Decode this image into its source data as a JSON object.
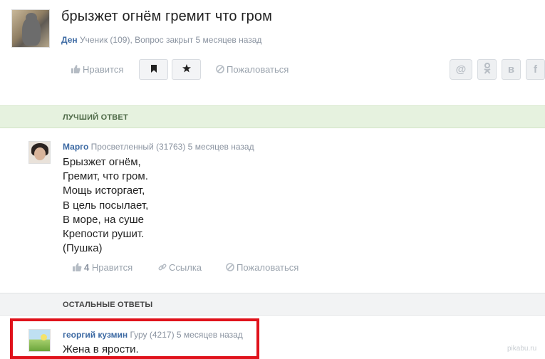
{
  "question": {
    "title": "брызжет огнём гремит что гром",
    "author": "Ден",
    "meta": "Ученик (109), Вопрос закрыт 5 месяцев назад"
  },
  "actions": {
    "like_label": "Нравится",
    "report_label": "Пожаловаться",
    "share_icons": [
      "@",
      "ok",
      "в",
      "f"
    ]
  },
  "best_answer": {
    "section_label": "ЛУЧШИЙ ОТВЕТ",
    "author": "Марго",
    "meta": "Просветленный (31763) 5 месяцев назад",
    "lines": [
      "Брызжет огнём,",
      "Гремит, что гром.",
      "Мощь исторгает,",
      "В цель посылает,",
      "В море, на суше",
      "Крепости рушит.",
      "(Пушка)"
    ],
    "likes_count": "4",
    "like_label": "Нравится",
    "link_label": "Ссылка",
    "report_label": "Пожаловаться"
  },
  "other_answers": {
    "section_label": "ОСТАЛЬНЫЕ ОТВЕТЫ",
    "items": [
      {
        "author": "георгий кузмин",
        "meta": "Гуру (4217) 5 месяцев назад",
        "text": "Жена в ярости."
      }
    ]
  },
  "watermark": "pikabu.ru",
  "colors": {
    "author_link": "#3d6aa3",
    "best_band": "#e6f2df",
    "highlight_border": "#e0121b"
  }
}
